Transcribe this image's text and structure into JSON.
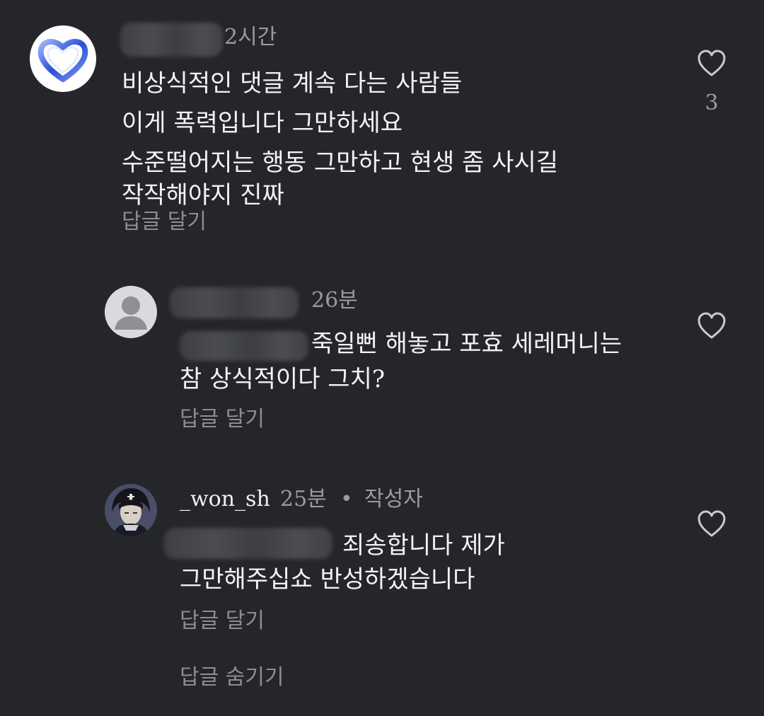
{
  "comments": [
    {
      "time": "2시간",
      "lines": [
        "비상식적인 댓글 계속 다는 사람들",
        "이게 폭력입니다 그만하세요",
        "수준떨어지는 행동 그만하고 현생 좀 사시길",
        "작작해야지 진짜"
      ],
      "reply_label": "답글 달기",
      "like_count": "3",
      "avatar_icon": "blue-heart-icon"
    }
  ],
  "replies": [
    {
      "time": "26분",
      "lines": [
        "죽일뻔 해놓고 포효 세레머니는",
        "참 상식적이다 그치?"
      ],
      "reply_label": "답글 달기",
      "avatar_icon": "default-user-icon"
    },
    {
      "username": "_won_sh",
      "time": "25분",
      "separator": "•",
      "author_badge": "작성자",
      "lines": [
        "죄송합니다 제가",
        "그만해주십쇼 반성하겠습니다"
      ],
      "reply_label": "답글 달기",
      "avatar_icon": "anime-character-avatar"
    }
  ],
  "hide_replies_label": "답글 숨기기",
  "colors": {
    "background": "#25262a",
    "text": "#f3f3f3",
    "muted": "#9a9ba0"
  }
}
